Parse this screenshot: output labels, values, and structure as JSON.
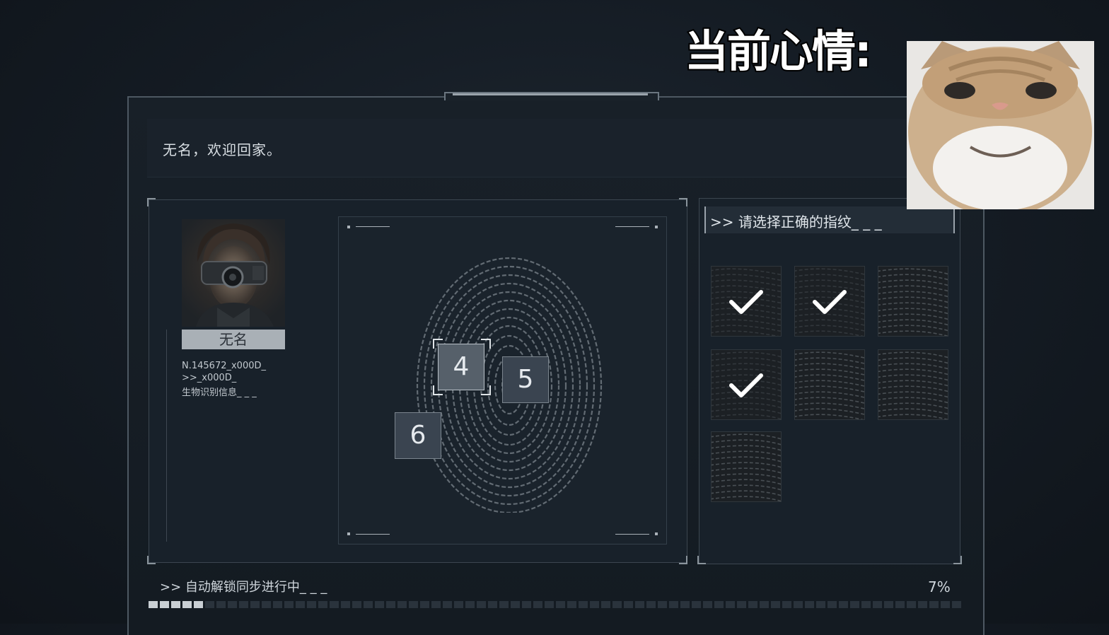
{
  "welcome": {
    "text": "无名，欢迎回家。"
  },
  "profile": {
    "name": "无名",
    "id_line": "N.145672_x000D_",
    "code_line": ">>_x000D_",
    "bio_line": "生物识别信息_ _ _"
  },
  "scanner": {
    "number_boxes": [
      "4",
      "5",
      "6"
    ],
    "selected": "4"
  },
  "selection": {
    "prompt": ">> 请选择正确的指纹_ _ _",
    "tiles": [
      {
        "checked": true
      },
      {
        "checked": true
      },
      {
        "checked": false
      },
      {
        "checked": true
      },
      {
        "checked": false
      },
      {
        "checked": false
      },
      {
        "checked": false
      }
    ]
  },
  "progress": {
    "label": ">> 自动解锁同步进行中_ _ _",
    "percent_text": "7%",
    "percent": 7
  },
  "overlay": {
    "mood_title": "当前心情:"
  },
  "colors": {
    "background": "#141b23",
    "panel": "#18212a",
    "accent": "#c9cfd4"
  }
}
